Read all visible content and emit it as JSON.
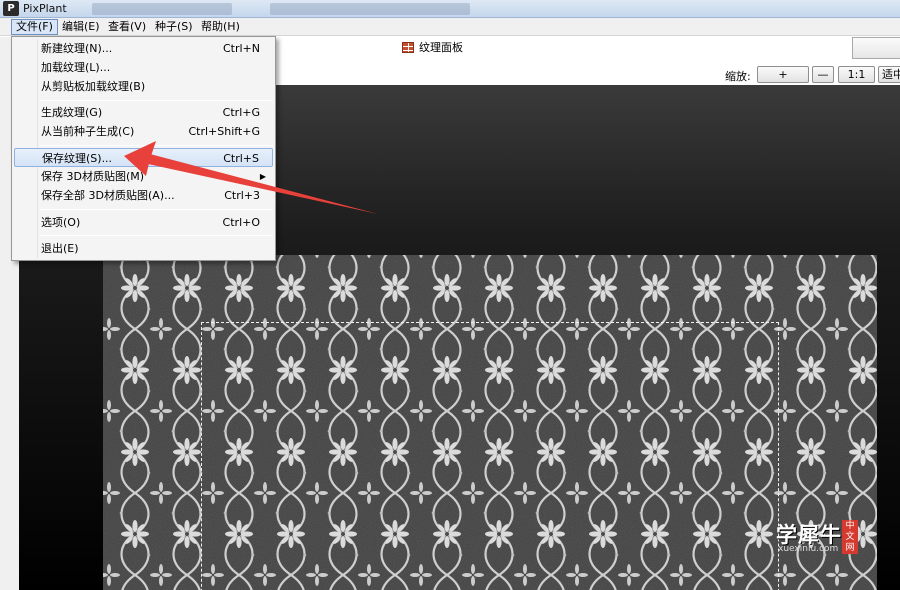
{
  "window": {
    "title": "PixPlant",
    "icon": "pixplant-app-icon"
  },
  "menubar": {
    "items": [
      {
        "label": "文件(F)",
        "active": true
      },
      {
        "label": "编辑(E)"
      },
      {
        "label": "查看(V)"
      },
      {
        "label": "种子(S)"
      },
      {
        "label": "帮助(H)"
      }
    ]
  },
  "file_menu": {
    "items": [
      {
        "label": "新建纹理(N)...",
        "shortcut": "Ctrl+N"
      },
      {
        "label": "加载纹理(L)...",
        "shortcut": ""
      },
      {
        "label": "从剪贴板加载纹理(B)",
        "shortcut": ""
      },
      {
        "label": "生成纹理(G)",
        "shortcut": "Ctrl+G"
      },
      {
        "label": "从当前种子生成(C)",
        "shortcut": "Ctrl+Shift+G"
      },
      {
        "label": "保存纹理(S)...",
        "shortcut": "Ctrl+S",
        "highlighted": true
      },
      {
        "label": "保存 3D材质贴图(M)",
        "shortcut": "",
        "submenu": true
      },
      {
        "label": "保存全部 3D材质贴图(A)...",
        "shortcut": "Ctrl+3"
      },
      {
        "label": "选项(O)",
        "shortcut": "Ctrl+O"
      },
      {
        "label": "退出(E)",
        "shortcut": ""
      }
    ]
  },
  "panel": {
    "title": "纹理面板",
    "icon": "texture-panel-icon"
  },
  "zoom": {
    "label": "缩放:",
    "buttons": [
      "+",
      "—",
      "1:1",
      "适中"
    ]
  },
  "watermark": {
    "main": "学犀牛",
    "sub": "xuexiniu.com",
    "badge": "中文网"
  },
  "colors": {
    "annotation_arrow": "#e8403a",
    "menu_highlight": "#d4e3f6",
    "viewport_bg": "#000000",
    "texture_base": "#3a3a3a",
    "texture_pattern": "#d8d8d8"
  }
}
